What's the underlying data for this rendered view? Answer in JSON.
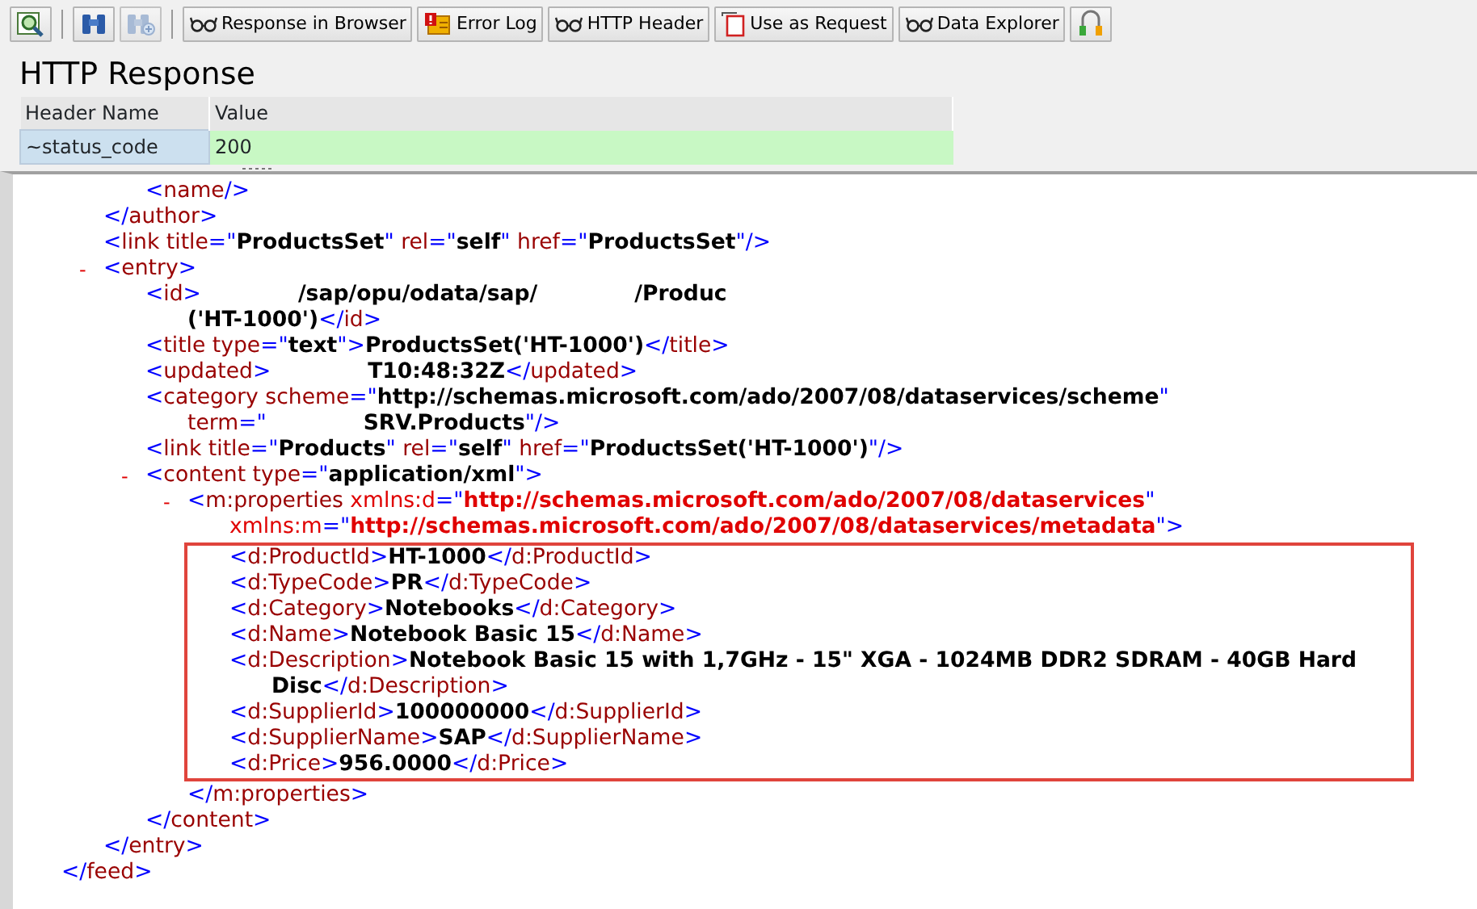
{
  "toolbar": {
    "buttons": [
      {
        "kind": "icon",
        "disabled": false
      },
      {
        "kind": "separator"
      },
      {
        "kind": "icon",
        "disabled": false
      },
      {
        "kind": "icon",
        "disabled": true
      },
      {
        "kind": "separator"
      },
      {
        "kind": "text",
        "label": "Response in Browser"
      },
      {
        "kind": "text",
        "label": "Error Log"
      },
      {
        "kind": "text",
        "label": "HTTP Header"
      },
      {
        "kind": "text",
        "label": "Use as Request"
      },
      {
        "kind": "text",
        "label": "Data Explorer"
      },
      {
        "kind": "icon",
        "disabled": false
      }
    ]
  },
  "title": "HTTP Response",
  "header_table": {
    "columns": [
      "Header Name",
      "Value"
    ],
    "rows": [
      [
        "~status_code",
        "200"
      ]
    ]
  },
  "xml": {
    "nodes": [
      {
        "close": [
          {
            "text": "</",
            "kind": "punct"
          },
          {
            "text": "feed",
            "kind": "tag"
          },
          {
            "text": ">",
            "kind": "punct"
          }
        ],
        "children": [
          {
            "close": [
              {
                "text": "</",
                "kind": "punct"
              },
              {
                "text": "author",
                "kind": "tag"
              },
              {
                "text": ">",
                "kind": "punct"
              }
            ],
            "children": [
              {
                "line": [
                  {
                    "text": "<",
                    "kind": "punct"
                  },
                  {
                    "text": "name",
                    "kind": "tag"
                  },
                  {
                    "text": "/>",
                    "kind": "punct"
                  }
                ]
              }
            ]
          },
          {
            "line": [
              {
                "text": "<",
                "kind": "punct"
              },
              {
                "text": "link",
                "kind": "tag"
              },
              {
                "text": " title",
                "kind": "attr"
              },
              {
                "text": "=\"",
                "kind": "punct"
              },
              {
                "text": "ProductsSet",
                "kind": "value"
              },
              {
                "text": "\"",
                "kind": "punct"
              },
              {
                "text": " rel",
                "kind": "attr"
              },
              {
                "text": "=\"",
                "kind": "punct"
              },
              {
                "text": "self",
                "kind": "value"
              },
              {
                "text": "\"",
                "kind": "punct"
              },
              {
                "text": " href",
                "kind": "attr"
              },
              {
                "text": "=\"",
                "kind": "punct"
              },
              {
                "text": "ProductsSet",
                "kind": "value"
              },
              {
                "text": "\"/>",
                "kind": "punct"
              }
            ]
          },
          {
            "toggle": "-",
            "line": [
              {
                "text": "<",
                "kind": "punct"
              },
              {
                "text": "entry",
                "kind": "tag"
              },
              {
                "text": ">",
                "kind": "punct"
              }
            ],
            "close": [
              {
                "text": "</",
                "kind": "punct"
              },
              {
                "text": "entry",
                "kind": "tag"
              },
              {
                "text": ">",
                "kind": "punct"
              }
            ],
            "children": [
              {
                "line": [
                  {
                    "text": "<",
                    "kind": "punct"
                  },
                  {
                    "text": "id",
                    "kind": "tag"
                  },
                  {
                    "text": ">",
                    "kind": "punct"
                  },
                  {
                    "text": "/sap/opu/odata/sap/",
                    "kind": "value",
                    "gap": true
                  },
                  {
                    "text": "/Produc",
                    "kind": "value",
                    "gap": true
                  }
                ],
                "cont": [
                  {
                    "text": "('HT-1000')",
                    "kind": "value"
                  },
                  {
                    "text": "</",
                    "kind": "punct"
                  },
                  {
                    "text": "id",
                    "kind": "tag"
                  },
                  {
                    "text": ">",
                    "kind": "punct"
                  }
                ]
              },
              {
                "line": [
                  {
                    "text": "<",
                    "kind": "punct"
                  },
                  {
                    "text": "title",
                    "kind": "tag"
                  },
                  {
                    "text": " type",
                    "kind": "attr"
                  },
                  {
                    "text": "=\"",
                    "kind": "punct"
                  },
                  {
                    "text": "text",
                    "kind": "value"
                  },
                  {
                    "text": "\">",
                    "kind": "punct"
                  },
                  {
                    "text": "ProductsSet('HT-1000')",
                    "kind": "value"
                  },
                  {
                    "text": "</",
                    "kind": "punct"
                  },
                  {
                    "text": "title",
                    "kind": "tag"
                  },
                  {
                    "text": ">",
                    "kind": "punct"
                  }
                ]
              },
              {
                "line": [
                  {
                    "text": "<",
                    "kind": "punct"
                  },
                  {
                    "text": "updated",
                    "kind": "tag"
                  },
                  {
                    "text": ">",
                    "kind": "punct"
                  },
                  {
                    "text": "T10:48:32Z",
                    "kind": "value",
                    "gap": true
                  },
                  {
                    "text": "</",
                    "kind": "punct"
                  },
                  {
                    "text": "updated",
                    "kind": "tag"
                  },
                  {
                    "text": ">",
                    "kind": "punct"
                  }
                ]
              },
              {
                "line": [
                  {
                    "text": "<",
                    "kind": "punct"
                  },
                  {
                    "text": "category",
                    "kind": "tag"
                  },
                  {
                    "text": " scheme",
                    "kind": "attr"
                  },
                  {
                    "text": "=\"",
                    "kind": "punct"
                  },
                  {
                    "text": "http://schemas.microsoft.com/ado/2007/08/dataservices/scheme",
                    "kind": "value"
                  },
                  {
                    "text": "\"",
                    "kind": "punct"
                  }
                ],
                "cont": [
                  {
                    "text": "term",
                    "kind": "attr"
                  },
                  {
                    "text": "=\"",
                    "kind": "punct"
                  },
                  {
                    "text": "SRV.Products",
                    "kind": "value",
                    "gap": true
                  },
                  {
                    "text": "\"/>",
                    "kind": "punct"
                  }
                ]
              },
              {
                "line": [
                  {
                    "text": "<",
                    "kind": "punct"
                  },
                  {
                    "text": "link",
                    "kind": "tag"
                  },
                  {
                    "text": " title",
                    "kind": "attr"
                  },
                  {
                    "text": "=\"",
                    "kind": "punct"
                  },
                  {
                    "text": "Products",
                    "kind": "value"
                  },
                  {
                    "text": "\"",
                    "kind": "punct"
                  },
                  {
                    "text": " rel",
                    "kind": "attr"
                  },
                  {
                    "text": "=\"",
                    "kind": "punct"
                  },
                  {
                    "text": "self",
                    "kind": "value"
                  },
                  {
                    "text": "\"",
                    "kind": "punct"
                  },
                  {
                    "text": " href",
                    "kind": "attr"
                  },
                  {
                    "text": "=\"",
                    "kind": "punct"
                  },
                  {
                    "text": "ProductsSet('HT-1000')",
                    "kind": "value"
                  },
                  {
                    "text": "\"/>",
                    "kind": "punct"
                  }
                ]
              },
              {
                "toggle": "-",
                "line": [
                  {
                    "text": "<",
                    "kind": "punct"
                  },
                  {
                    "text": "content",
                    "kind": "tag"
                  },
                  {
                    "text": " type",
                    "kind": "attr"
                  },
                  {
                    "text": "=\"",
                    "kind": "punct"
                  },
                  {
                    "text": "application/xml",
                    "kind": "value"
                  },
                  {
                    "text": "\">",
                    "kind": "punct"
                  }
                ],
                "close": [
                  {
                    "text": "</",
                    "kind": "punct"
                  },
                  {
                    "text": "content",
                    "kind": "tag"
                  },
                  {
                    "text": ">",
                    "kind": "punct"
                  }
                ],
                "children": [
                  {
                    "toggle": "-",
                    "highlighted": true,
                    "line": [
                      {
                        "text": "<",
                        "kind": "punct"
                      },
                      {
                        "text": "m:properties",
                        "kind": "tag"
                      },
                      {
                        "text": " xmlns:d",
                        "kind": "ns"
                      },
                      {
                        "text": "=\"",
                        "kind": "punct"
                      },
                      {
                        "text": "http://schemas.microsoft.com/ado/2007/08/dataservices",
                        "kind": "nsvalue"
                      },
                      {
                        "text": "\"",
                        "kind": "punct"
                      }
                    ],
                    "cont": [
                      {
                        "text": "xmlns:m",
                        "kind": "ns"
                      },
                      {
                        "text": "=\"",
                        "kind": "punct"
                      },
                      {
                        "text": "http://schemas.microsoft.com/ado/2007/08/dataservices/metadata",
                        "kind": "nsvalue"
                      },
                      {
                        "text": "\">",
                        "kind": "punct"
                      }
                    ],
                    "close": [
                      {
                        "text": "</",
                        "kind": "punct"
                      },
                      {
                        "text": "m:properties",
                        "kind": "tag"
                      },
                      {
                        "text": ">",
                        "kind": "punct"
                      }
                    ],
                    "children": [
                      {
                        "line": [
                          {
                            "text": "<",
                            "kind": "punct"
                          },
                          {
                            "text": "d:ProductId",
                            "kind": "tag"
                          },
                          {
                            "text": ">",
                            "kind": "punct"
                          },
                          {
                            "text": "HT-1000",
                            "kind": "value"
                          },
                          {
                            "text": "</",
                            "kind": "punct"
                          },
                          {
                            "text": "d:ProductId",
                            "kind": "tag"
                          },
                          {
                            "text": ">",
                            "kind": "punct"
                          }
                        ]
                      },
                      {
                        "line": [
                          {
                            "text": "<",
                            "kind": "punct"
                          },
                          {
                            "text": "d:TypeCode",
                            "kind": "tag"
                          },
                          {
                            "text": ">",
                            "kind": "punct"
                          },
                          {
                            "text": "PR",
                            "kind": "value"
                          },
                          {
                            "text": "</",
                            "kind": "punct"
                          },
                          {
                            "text": "d:TypeCode",
                            "kind": "tag"
                          },
                          {
                            "text": ">",
                            "kind": "punct"
                          }
                        ]
                      },
                      {
                        "line": [
                          {
                            "text": "<",
                            "kind": "punct"
                          },
                          {
                            "text": "d:Category",
                            "kind": "tag"
                          },
                          {
                            "text": ">",
                            "kind": "punct"
                          },
                          {
                            "text": "Notebooks",
                            "kind": "value"
                          },
                          {
                            "text": "</",
                            "kind": "punct"
                          },
                          {
                            "text": "d:Category",
                            "kind": "tag"
                          },
                          {
                            "text": ">",
                            "kind": "punct"
                          }
                        ]
                      },
                      {
                        "line": [
                          {
                            "text": "<",
                            "kind": "punct"
                          },
                          {
                            "text": "d:Name",
                            "kind": "tag"
                          },
                          {
                            "text": ">",
                            "kind": "punct"
                          },
                          {
                            "text": "Notebook Basic 15",
                            "kind": "value"
                          },
                          {
                            "text": "</",
                            "kind": "punct"
                          },
                          {
                            "text": "d:Name",
                            "kind": "tag"
                          },
                          {
                            "text": ">",
                            "kind": "punct"
                          }
                        ]
                      },
                      {
                        "line": [
                          {
                            "text": "<",
                            "kind": "punct"
                          },
                          {
                            "text": "d:Description",
                            "kind": "tag"
                          },
                          {
                            "text": ">",
                            "kind": "punct"
                          },
                          {
                            "text": "Notebook Basic 15 with 1,7GHz - 15\" XGA - 1024MB DDR2 SDRAM - 40GB Hard",
                            "kind": "value"
                          }
                        ],
                        "cont": [
                          {
                            "text": "Disc",
                            "kind": "value"
                          },
                          {
                            "text": "</",
                            "kind": "punct"
                          },
                          {
                            "text": "d:Description",
                            "kind": "tag"
                          },
                          {
                            "text": ">",
                            "kind": "punct"
                          }
                        ]
                      },
                      {
                        "line": [
                          {
                            "text": "<",
                            "kind": "punct"
                          },
                          {
                            "text": "d:SupplierId",
                            "kind": "tag"
                          },
                          {
                            "text": ">",
                            "kind": "punct"
                          },
                          {
                            "text": "100000000",
                            "kind": "value"
                          },
                          {
                            "text": "</",
                            "kind": "punct"
                          },
                          {
                            "text": "d:SupplierId",
                            "kind": "tag"
                          },
                          {
                            "text": ">",
                            "kind": "punct"
                          }
                        ]
                      },
                      {
                        "line": [
                          {
                            "text": "<",
                            "kind": "punct"
                          },
                          {
                            "text": "d:SupplierName",
                            "kind": "tag"
                          },
                          {
                            "text": ">",
                            "kind": "punct"
                          },
                          {
                            "text": "SAP",
                            "kind": "value"
                          },
                          {
                            "text": "</",
                            "kind": "punct"
                          },
                          {
                            "text": "d:SupplierName",
                            "kind": "tag"
                          },
                          {
                            "text": ">",
                            "kind": "punct"
                          }
                        ]
                      },
                      {
                        "line": [
                          {
                            "text": "<",
                            "kind": "punct"
                          },
                          {
                            "text": "d:Price",
                            "kind": "tag"
                          },
                          {
                            "text": ">",
                            "kind": "punct"
                          },
                          {
                            "text": "956.0000",
                            "kind": "value"
                          },
                          {
                            "text": "</",
                            "kind": "punct"
                          },
                          {
                            "text": "d:Price",
                            "kind": "tag"
                          },
                          {
                            "text": ">",
                            "kind": "punct"
                          }
                        ]
                      }
                    ]
                  }
                ]
              }
            ]
          }
        ]
      }
    ]
  }
}
